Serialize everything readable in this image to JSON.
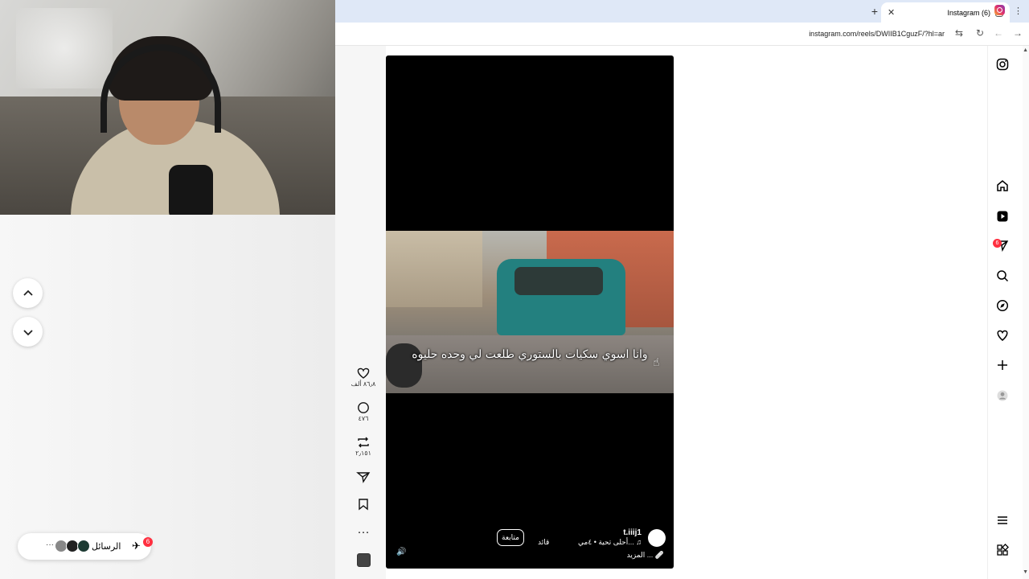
{
  "browser": {
    "tab_title": "(6) Instagram",
    "url": "instagram.com/reels/DWIIB1CguzF/?hl=ar",
    "new_tab_symbol": "+",
    "close_symbol": "✕"
  },
  "reel": {
    "caption": "وانا اسوي سكيات بالستوري طلعت لي وحده حليوه",
    "username": "t.iiij1",
    "audio": "♫ ...أحلى تحية • ٤مي",
    "follow_label": "متابعة",
    "more_menu": "قائد",
    "description": "🩹 ... المزيد",
    "volume_icon": "🔊"
  },
  "actions": {
    "likes": "٨٦٫٨ ألف",
    "comments": "٤٧٦",
    "reposts": "٢٫١٥١"
  },
  "messages": {
    "label": "الرسائل",
    "badge": "6",
    "more": "···"
  },
  "nav": {
    "notification_badge": "6"
  },
  "colors": {
    "tabbar": "#dfe8f7",
    "badge": "#ff3040",
    "reel_bg": "#000000"
  },
  "icons": [
    "instagram-icon",
    "home-icon",
    "reels-icon",
    "messages-icon",
    "search-icon",
    "explore-icon",
    "heart-icon",
    "create-icon",
    "profile-icon",
    "menu-icon",
    "apps-icon"
  ]
}
